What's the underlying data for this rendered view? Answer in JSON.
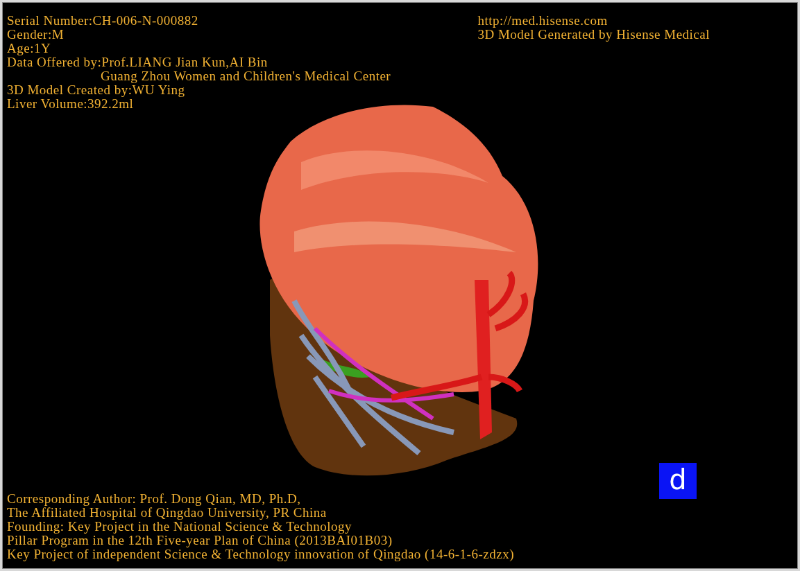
{
  "info_top_left": [
    {
      "text": "Serial Number:CH-006-N-000882",
      "indented": false
    },
    {
      "text": "Gender:M",
      "indented": false
    },
    {
      "text": "Age:1Y",
      "indented": false
    },
    {
      "text": "Data Offered by:Prof.LIANG Jian Kun,AI Bin",
      "indented": false
    },
    {
      "text": "Guang Zhou Women and Children's Medical Center",
      "indented": true
    },
    {
      "text": "3D Model Created by:WU Ying",
      "indented": false
    },
    {
      "text": "Liver Volume:392.2ml",
      "indented": false
    }
  ],
  "info_top_right": [
    "http://med.hisense.com",
    "3D Model Generated by Hisense Medical"
  ],
  "orientation_marker": "d",
  "info_bottom": [
    "Corresponding Author: Prof. Dong Qian, MD, Ph.D,",
    "The Affiliated Hospital of Qingdao University, PR China",
    "Founding: Key Project in the National Science & Technology",
    "Pillar Program in the 12th Five-year Plan of China (2013BAI01B03)",
    "Key Project of independent Science & Technology innovation of Qingdao (14-6-1-6-zdzx)"
  ]
}
